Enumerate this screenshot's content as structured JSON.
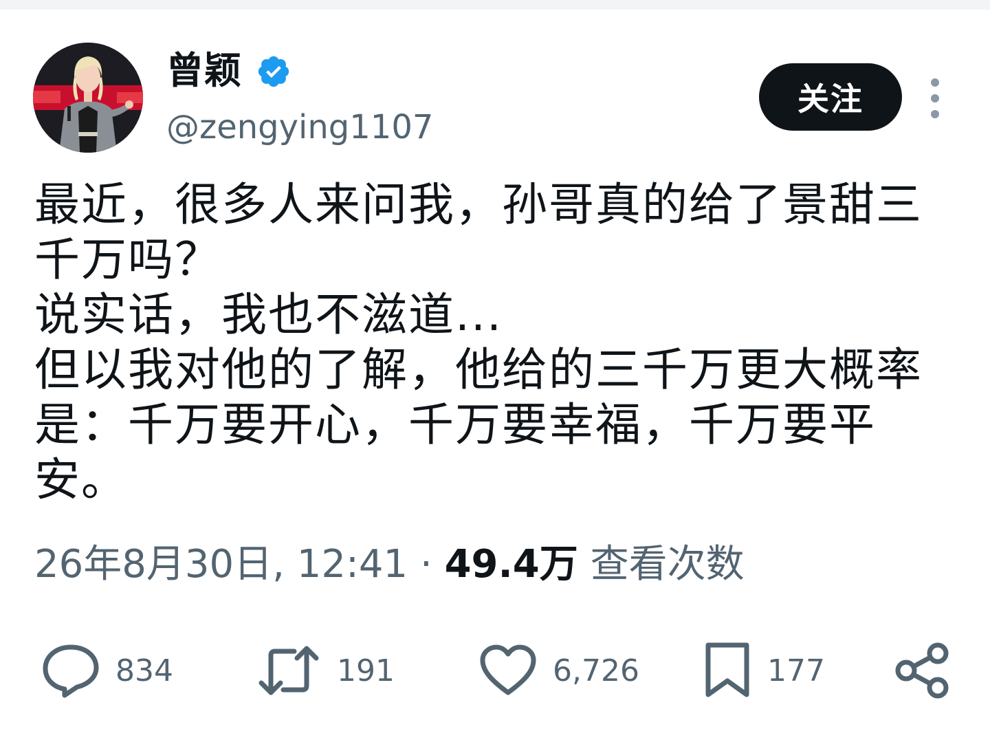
{
  "author": {
    "display_name": "曾颖",
    "handle": "@zengying1107",
    "verified": true,
    "verified_color": "#1d9bf0"
  },
  "follow_label": "关注",
  "post": {
    "lines": [
      "最近，很多人来问我，孙哥真的给了景甜三",
      "千万吗？",
      "说实话，我也不滋道...",
      "但以我对他的了解，他给的三千万更大概率",
      "是：千万要开心，千万要幸福，千万要平",
      "安。"
    ]
  },
  "meta": {
    "timestamp": "26年8月30日, 12:41",
    "separator": "·",
    "views_count": "49.4万",
    "views_label": "查看次数"
  },
  "actions": {
    "reply": {
      "icon": "reply-icon",
      "count": "834"
    },
    "retweet": {
      "icon": "retweet-icon",
      "count": "191"
    },
    "like": {
      "icon": "heart-icon",
      "count": "6,726"
    },
    "bookmark": {
      "icon": "bookmark-icon",
      "count": "177"
    },
    "share": {
      "icon": "share-icon"
    }
  },
  "colors": {
    "text_primary": "#0f1419",
    "text_secondary": "#536471",
    "button_bg": "#0f1419"
  }
}
